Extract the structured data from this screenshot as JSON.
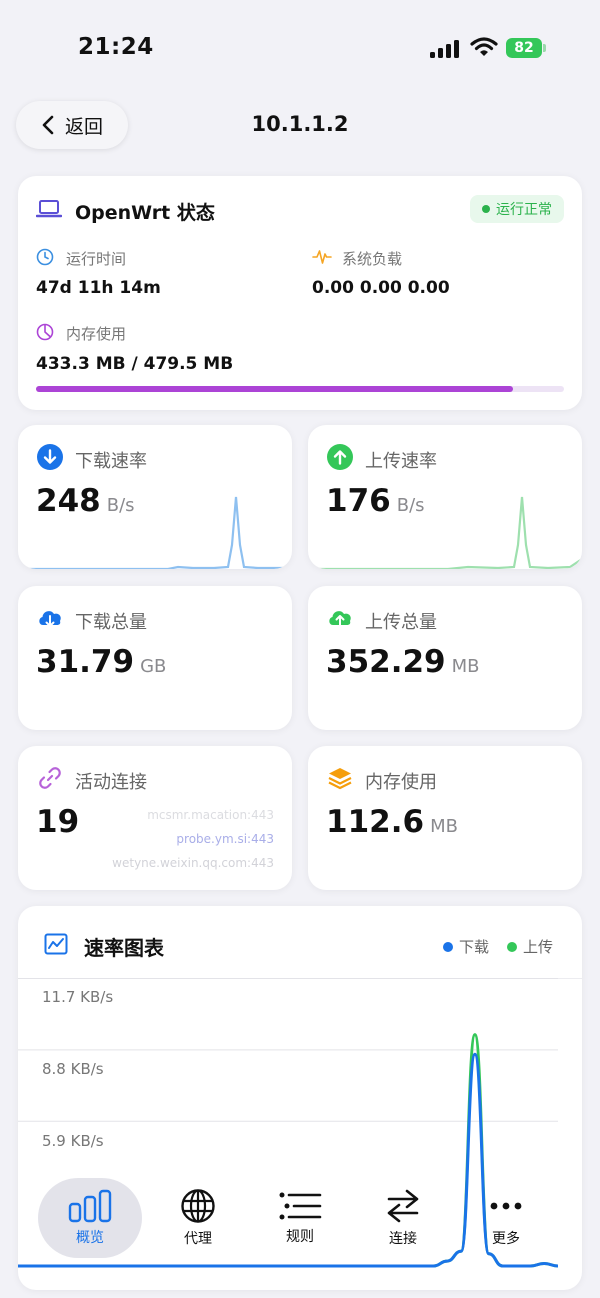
{
  "status_bar": {
    "time": "21:24",
    "battery": "82"
  },
  "header": {
    "back_label": "返回",
    "title": "10.1.1.2"
  },
  "system": {
    "title": "OpenWrt 状态",
    "status_badge": "运行正常",
    "uptime_label": "运行时间",
    "uptime_value": "47d 11h 14m",
    "load_label": "系统负载",
    "load_value": "0.00 0.00 0.00",
    "memory_label": "内存使用",
    "memory_value": "433.3 MB / 479.5 MB",
    "memory_used_fraction": 0.904
  },
  "stats": {
    "download_rate": {
      "label": "下载速率",
      "value": "248",
      "unit": "B/s"
    },
    "upload_rate": {
      "label": "上传速率",
      "value": "176",
      "unit": "B/s"
    },
    "download_total": {
      "label": "下载总量",
      "value": "31.79",
      "unit": "GB"
    },
    "upload_total": {
      "label": "上传总量",
      "value": "352.29",
      "unit": "MB"
    },
    "connections": {
      "label": "活动连接",
      "value": "19",
      "hosts": [
        "mcsmr.macation:443",
        "probe.ym.si:443",
        "wetyne.weixin.qq.com:443"
      ]
    },
    "memory": {
      "label": "内存使用",
      "value": "112.6",
      "unit": "MB"
    }
  },
  "rate_chart": {
    "title": "速率图表",
    "legend_download": "下载",
    "legend_upload": "上传"
  },
  "chart_data": {
    "type": "line",
    "title": "速率图表",
    "y_ticks": [
      "11.7 KB/s",
      "8.8 KB/s",
      "5.9 KB/s"
    ],
    "series": [
      {
        "name": "下载",
        "color": "#1a73e8",
        "values": [
          0,
          0,
          0,
          0,
          0,
          0,
          0,
          0,
          0,
          0,
          0,
          0,
          0,
          0,
          0,
          0,
          0,
          0,
          0,
          0,
          0,
          0,
          0,
          0,
          0,
          0,
          0,
          0,
          0,
          0,
          0,
          0.2,
          0.6,
          8.6,
          0.5,
          0,
          0,
          0,
          0.1,
          0
        ]
      },
      {
        "name": "上传",
        "color": "#34c759",
        "values": [
          0,
          0,
          0,
          0,
          0,
          0,
          0,
          0,
          0,
          0,
          0,
          0,
          0,
          0,
          0,
          0,
          0,
          0,
          0,
          0,
          0,
          0,
          0,
          0,
          0,
          0,
          0,
          0,
          0,
          0,
          0,
          0.2,
          0.6,
          9.4,
          0.5,
          0,
          0,
          0,
          0.1,
          0
        ]
      }
    ],
    "ylim": [
      0,
      11.7
    ],
    "grid": true,
    "legend": "top-right"
  },
  "nav": {
    "items": [
      {
        "label": "概览"
      },
      {
        "label": "代理"
      },
      {
        "label": "规则"
      },
      {
        "label": "连接"
      },
      {
        "label": "更多"
      }
    ]
  },
  "colors": {
    "accent": "#1a73e8",
    "upload": "#34c759",
    "memory": "#ac44d6",
    "ok": "#2bb24c"
  }
}
